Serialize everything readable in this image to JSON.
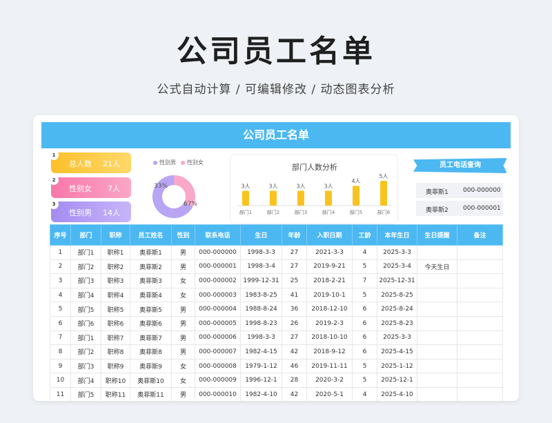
{
  "hero": {
    "title": "公司员工名单",
    "subtitle": "公式自动计算 /  可编辑修改  / 动态图表分析"
  },
  "sheet": {
    "banner_title": "公司员工名单",
    "stats": [
      {
        "index": "1",
        "label": "总人数",
        "value": "21人",
        "color": "#fcc02a"
      },
      {
        "index": "2",
        "label": "性别女",
        "value": "7人",
        "color": "#f777a9"
      },
      {
        "index": "3",
        "label": "性别男",
        "value": "14人",
        "color": "#a48cf0"
      }
    ],
    "gender_chart": {
      "legend": [
        {
          "name": "性别男",
          "color": "#b8a6f5"
        },
        {
          "name": "性别女",
          "color": "#f9a8c9"
        }
      ],
      "male_pct": "67%",
      "female_pct": "33%",
      "male_fraction": 0.67
    },
    "lookup": {
      "button_label": "员工电话查询",
      "rows": [
        {
          "name": "奥菲斯1",
          "phone": "000-000000"
        },
        {
          "name": "奥菲斯2",
          "phone": "000-000001"
        }
      ]
    },
    "table": {
      "headers": [
        "序号",
        "部门",
        "职称",
        "员工姓名",
        "性别",
        "联系电话",
        "生日",
        "年龄",
        "入职日期",
        "工龄",
        "本年生日",
        "生日提醒",
        "备注"
      ],
      "rows": [
        [
          "1",
          "部门1",
          "职称1",
          "奥菲斯1",
          "男",
          "000-000000",
          "1998-3-3",
          "27",
          "2021-3-3",
          "4",
          "2025-3-3",
          "",
          ""
        ],
        [
          "2",
          "部门2",
          "职称2",
          "奥菲斯2",
          "男",
          "000-000001",
          "1998-3-4",
          "27",
          "2019-9-21",
          "5",
          "2025-3-4",
          "今天生日",
          ""
        ],
        [
          "3",
          "部门3",
          "职称3",
          "奥菲斯3",
          "女",
          "000-000002",
          "1999-12-31",
          "25",
          "2018-2-21",
          "7",
          "2025-12-31",
          "",
          ""
        ],
        [
          "4",
          "部门4",
          "职称4",
          "奥菲斯4",
          "女",
          "000-000003",
          "1983-8-25",
          "41",
          "2019-10-1",
          "5",
          "2025-8-25",
          "",
          ""
        ],
        [
          "5",
          "部门5",
          "职称5",
          "奥菲斯5",
          "男",
          "000-000004",
          "1988-8-24",
          "36",
          "2018-12-10",
          "6",
          "2025-8-24",
          "",
          ""
        ],
        [
          "6",
          "部门6",
          "职称6",
          "奥菲斯6",
          "男",
          "000-000005",
          "1998-8-23",
          "26",
          "2019-2-3",
          "6",
          "2025-8-23",
          "",
          ""
        ],
        [
          "7",
          "部门1",
          "职称7",
          "奥菲斯7",
          "男",
          "000-000006",
          "1998-3-3",
          "27",
          "2018-10-10",
          "6",
          "2025-3-3",
          "",
          ""
        ],
        [
          "8",
          "部门2",
          "职称8",
          "奥菲斯8",
          "男",
          "000-000007",
          "1982-4-15",
          "42",
          "2018-9-12",
          "6",
          "2025-4-15",
          "",
          ""
        ],
        [
          "9",
          "部门3",
          "职称9",
          "奥菲斯9",
          "女",
          "000-000008",
          "1979-1-12",
          "46",
          "2019-11-11",
          "5",
          "2025-1-12",
          "",
          ""
        ],
        [
          "10",
          "部门4",
          "职称10",
          "奥菲斯10",
          "女",
          "000-000009",
          "1996-12-1",
          "28",
          "2020-3-2",
          "5",
          "2025-12-1",
          "",
          ""
        ],
        [
          "11",
          "部门5",
          "职称11",
          "奥菲斯11",
          "男",
          "000-000010",
          "1982-4-10",
          "42",
          "2020-5-1",
          "4",
          "2025-4-10",
          "",
          ""
        ]
      ]
    }
  },
  "chart_data": {
    "type": "bar",
    "title": "部门人数分析",
    "categories": [
      "部门1",
      "部门2",
      "部门3",
      "部门4",
      "部门5",
      "部门6"
    ],
    "values": [
      3,
      3,
      3,
      3,
      4,
      5
    ],
    "data_labels": [
      "3人",
      "3人",
      "3人",
      "3人",
      "4人",
      "5人"
    ],
    "bar_color": "#f9c31f",
    "ylim": [
      0,
      5
    ]
  }
}
